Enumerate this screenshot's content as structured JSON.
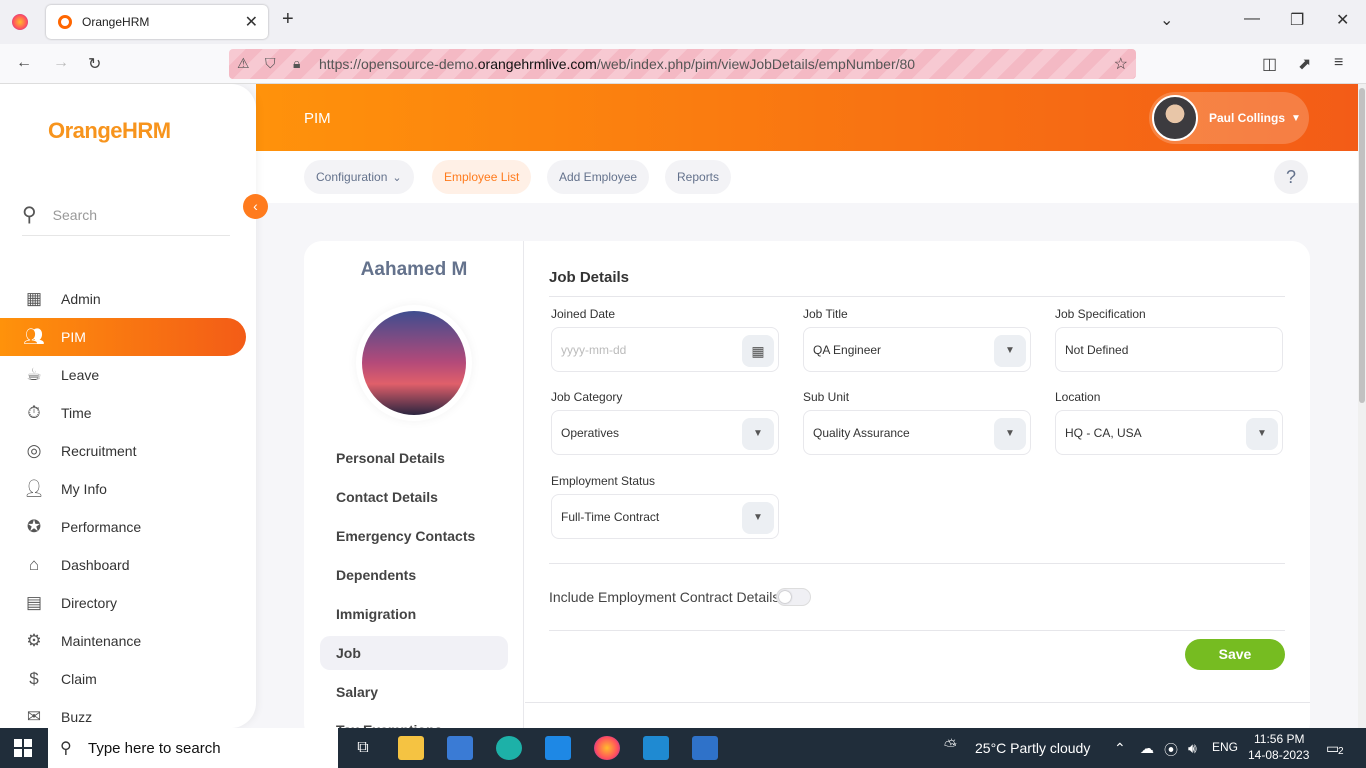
{
  "browser": {
    "tab_title": "OrangeHRM",
    "url_prefix": "https://opensource-demo.",
    "url_domain": "orangehrmlive.com",
    "url_path": "/web/index.php/pim/viewJobDetails/empNumber/80"
  },
  "sidebar": {
    "logo_orange": "Orange",
    "logo_hrm": "HRM",
    "search_placeholder": "Search",
    "items": [
      {
        "label": "Admin",
        "icon": "admin-icon"
      },
      {
        "label": "PIM",
        "icon": "pim-icon"
      },
      {
        "label": "Leave",
        "icon": "leave-icon"
      },
      {
        "label": "Time",
        "icon": "time-icon"
      },
      {
        "label": "Recruitment",
        "icon": "recruitment-icon"
      },
      {
        "label": "My Info",
        "icon": "my-info-icon"
      },
      {
        "label": "Performance",
        "icon": "performance-icon"
      },
      {
        "label": "Dashboard",
        "icon": "dashboard-icon"
      },
      {
        "label": "Directory",
        "icon": "directory-icon"
      },
      {
        "label": "Maintenance",
        "icon": "maintenance-icon"
      },
      {
        "label": "Claim",
        "icon": "claim-icon"
      },
      {
        "label": "Buzz",
        "icon": "buzz-icon"
      }
    ]
  },
  "header": {
    "title": "PIM",
    "user_name": "Paul Collings"
  },
  "subnav": {
    "configuration": "Configuration",
    "employee_list": "Employee List",
    "add_employee": "Add Employee",
    "reports": "Reports",
    "help": "?"
  },
  "employee": {
    "name": "Aahamed M",
    "links": [
      "Personal Details",
      "Contact Details",
      "Emergency Contacts",
      "Dependents",
      "Immigration",
      "Job",
      "Salary",
      "Tax Exemptions"
    ]
  },
  "job": {
    "section_title": "Job Details",
    "joined_date_label": "Joined Date",
    "joined_date_placeholder": "yyyy-mm-dd",
    "job_title_label": "Job Title",
    "job_title_value": "QA Engineer",
    "job_spec_label": "Job Specification",
    "job_spec_value": "Not Defined",
    "job_category_label": "Job Category",
    "job_category_value": "Operatives",
    "sub_unit_label": "Sub Unit",
    "sub_unit_value": "Quality Assurance",
    "location_label": "Location",
    "location_value": "HQ - CA, USA",
    "employment_status_label": "Employment Status",
    "employment_status_value": "Full-Time Contract",
    "contract_toggle_label": "Include Employment Contract Details",
    "save_label": "Save"
  },
  "taskbar": {
    "search_placeholder": "Type here to search",
    "weather": "25°C  Partly cloudy",
    "lang": "ENG",
    "time": "11:56 PM",
    "date": "14-08-2023",
    "notifications": "2"
  }
}
